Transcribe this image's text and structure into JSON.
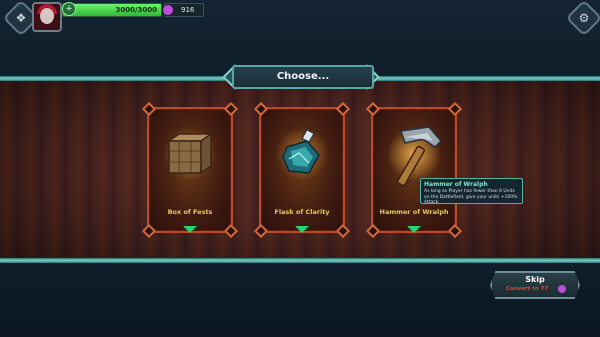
{
  "header": {
    "hp_text": "3000/3000",
    "hp_fraction": 1.0,
    "currency": "916"
  },
  "banner": {
    "title": "Choose..."
  },
  "cards": [
    {
      "name": "Box of Fests"
    },
    {
      "name": "Flask of Clarity"
    },
    {
      "name": "Hammer of Wralph"
    }
  ],
  "tooltip": {
    "title": "Hammer of Wralph",
    "desc": "As long as Player has fewer than 6 Units on the Battlefield, give your units +100% Attack"
  },
  "skip": {
    "label": "Skip",
    "sub": "Convert to 77"
  },
  "colors": {
    "accent": "#5aa6a4",
    "hp": "#4ee05a",
    "currency": "#c04cd8",
    "card_border": "#b94b2a"
  }
}
